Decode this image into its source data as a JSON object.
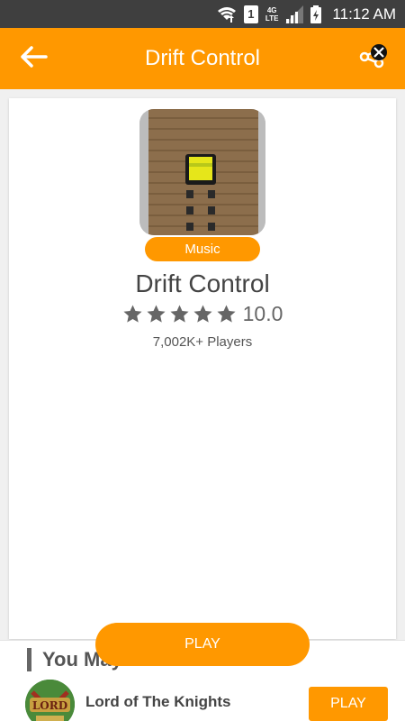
{
  "status_bar": {
    "sim_slot": "1",
    "network_label_top": "4G",
    "network_label_bottom": "LTE",
    "time": "11:12 AM"
  },
  "app_bar": {
    "title": "Drift Control",
    "back_icon": "arrow-left-icon",
    "share_icon": "share-icon",
    "background_color": "#ff9800"
  },
  "game": {
    "name": "Drift Control",
    "category": "Music",
    "rating": "10.0",
    "star_count": 5,
    "players": "7,002K+ Players"
  },
  "actions": {
    "play_label": "PLAY"
  },
  "you_may_like": {
    "heading": "You May Like",
    "items": [
      {
        "name": "Lord of The Knights",
        "play_label": "PLAY",
        "thumb_text": "LORD"
      }
    ]
  },
  "colors": {
    "accent": "#ff9800",
    "status_bar": "#3f3f3f",
    "star": "#666666"
  }
}
